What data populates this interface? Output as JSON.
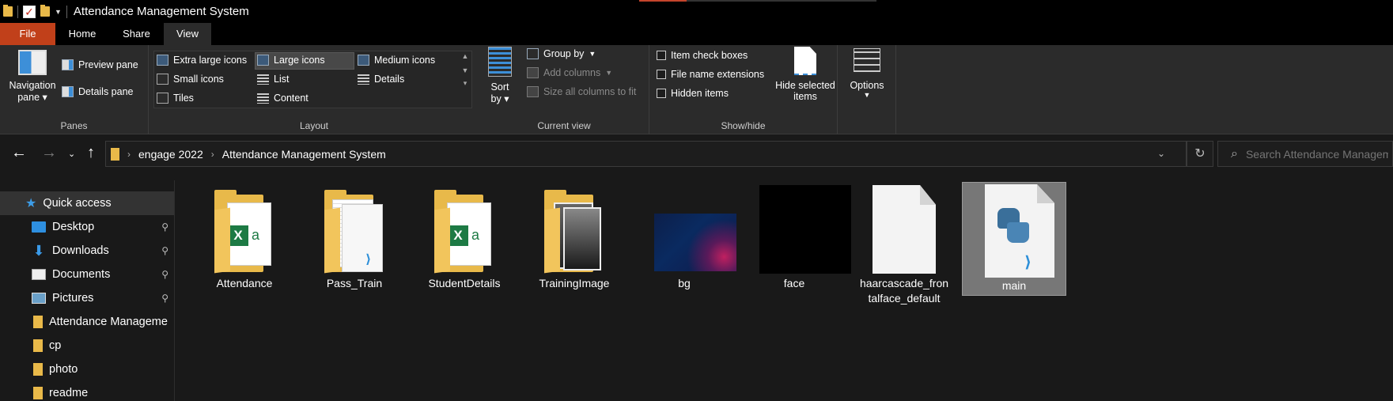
{
  "window": {
    "title": "Attendance Management System"
  },
  "tabs": [
    {
      "label": "File"
    },
    {
      "label": "Home"
    },
    {
      "label": "Share"
    },
    {
      "label": "View"
    }
  ],
  "ribbon": {
    "panes": {
      "label": "Panes",
      "navigation_pane": "Navigation",
      "navigation_pane_2": "pane",
      "preview_pane": "Preview pane",
      "details_pane": "Details pane"
    },
    "layout": {
      "label": "Layout",
      "options": [
        "Extra large icons",
        "Large icons",
        "Medium icons",
        "Small icons",
        "List",
        "Details",
        "Tiles",
        "Content"
      ],
      "selected": "Large icons"
    },
    "current_view": {
      "label": "Current view",
      "sort_by": "Sort",
      "sort_by_2": "by",
      "group_by": "Group by",
      "add_columns": "Add columns",
      "size_all_columns": "Size all columns to fit"
    },
    "show_hide": {
      "label": "Show/hide",
      "item_check_boxes": "Item check boxes",
      "file_name_extensions": "File name extensions",
      "hidden_items": "Hidden items",
      "hide_selected": "Hide selected",
      "hide_selected_2": "items"
    },
    "options": {
      "label": "Options"
    }
  },
  "address": {
    "breadcrumb": [
      "engage 2022",
      "Attendance Management System"
    ],
    "search_placeholder": "Search Attendance Managem..."
  },
  "sidebar": {
    "items": [
      {
        "label": "Quick access",
        "icon": "star-icon"
      },
      {
        "label": "Desktop",
        "icon": "desktop-icon",
        "pinned": true
      },
      {
        "label": "Downloads",
        "icon": "download-icon",
        "pinned": true
      },
      {
        "label": "Documents",
        "icon": "documents-icon",
        "pinned": true
      },
      {
        "label": "Pictures",
        "icon": "pictures-icon",
        "pinned": true
      },
      {
        "label": "Attendance Manageme",
        "icon": "folder-icon"
      },
      {
        "label": "cp",
        "icon": "folder-icon"
      },
      {
        "label": "photo",
        "icon": "folder-icon"
      },
      {
        "label": "readme",
        "icon": "folder-icon"
      }
    ]
  },
  "files": [
    {
      "name": "Attendance",
      "type": "folder"
    },
    {
      "name": "Pass_Train",
      "type": "folder"
    },
    {
      "name": "StudentDetails",
      "type": "folder"
    },
    {
      "name": "TrainingImage",
      "type": "folder"
    },
    {
      "name": "bg",
      "type": "image"
    },
    {
      "name": "face",
      "type": "image"
    },
    {
      "name": "haarcascade_fron",
      "name_2": "talface_default",
      "type": "xml"
    },
    {
      "name": "main",
      "type": "python",
      "selected": true
    }
  ],
  "colors": {
    "file_tab": "#c1401a",
    "folder": "#e8b94a",
    "accent": "#2d8fd8"
  }
}
